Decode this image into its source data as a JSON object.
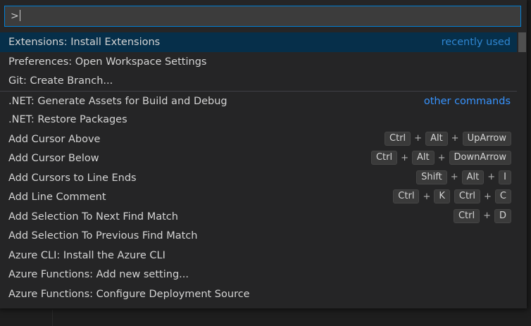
{
  "palette": {
    "input_value": ">",
    "items": [
      {
        "label": "Extensions: Install Extensions",
        "tag": "recently used",
        "selected": true
      },
      {
        "label": "Preferences: Open Workspace Settings"
      },
      {
        "label": "Git: Create Branch..."
      },
      {
        "label": ".NET: Generate Assets for Build and Debug",
        "tag": "other commands",
        "separator": true
      },
      {
        "label": ".NET: Restore Packages"
      },
      {
        "label": "Add Cursor Above",
        "keys": [
          "Ctrl",
          "Alt",
          "UpArrow"
        ]
      },
      {
        "label": "Add Cursor Below",
        "keys": [
          "Ctrl",
          "Alt",
          "DownArrow"
        ]
      },
      {
        "label": "Add Cursors to Line Ends",
        "keys": [
          "Shift",
          "Alt",
          "I"
        ]
      },
      {
        "label": "Add Line Comment",
        "chords": [
          [
            "Ctrl",
            "K"
          ],
          [
            "Ctrl",
            "C"
          ]
        ]
      },
      {
        "label": "Add Selection To Next Find Match",
        "keys": [
          "Ctrl",
          "D"
        ]
      },
      {
        "label": "Add Selection To Previous Find Match"
      },
      {
        "label": "Azure CLI: Install the Azure CLI"
      },
      {
        "label": "Azure Functions: Add new setting..."
      },
      {
        "label": "Azure Functions: Configure Deployment Source"
      }
    ]
  },
  "colors": {
    "selected_bg": "#062f4a",
    "tag": "#3794ff",
    "input_border": "#007fd4"
  }
}
